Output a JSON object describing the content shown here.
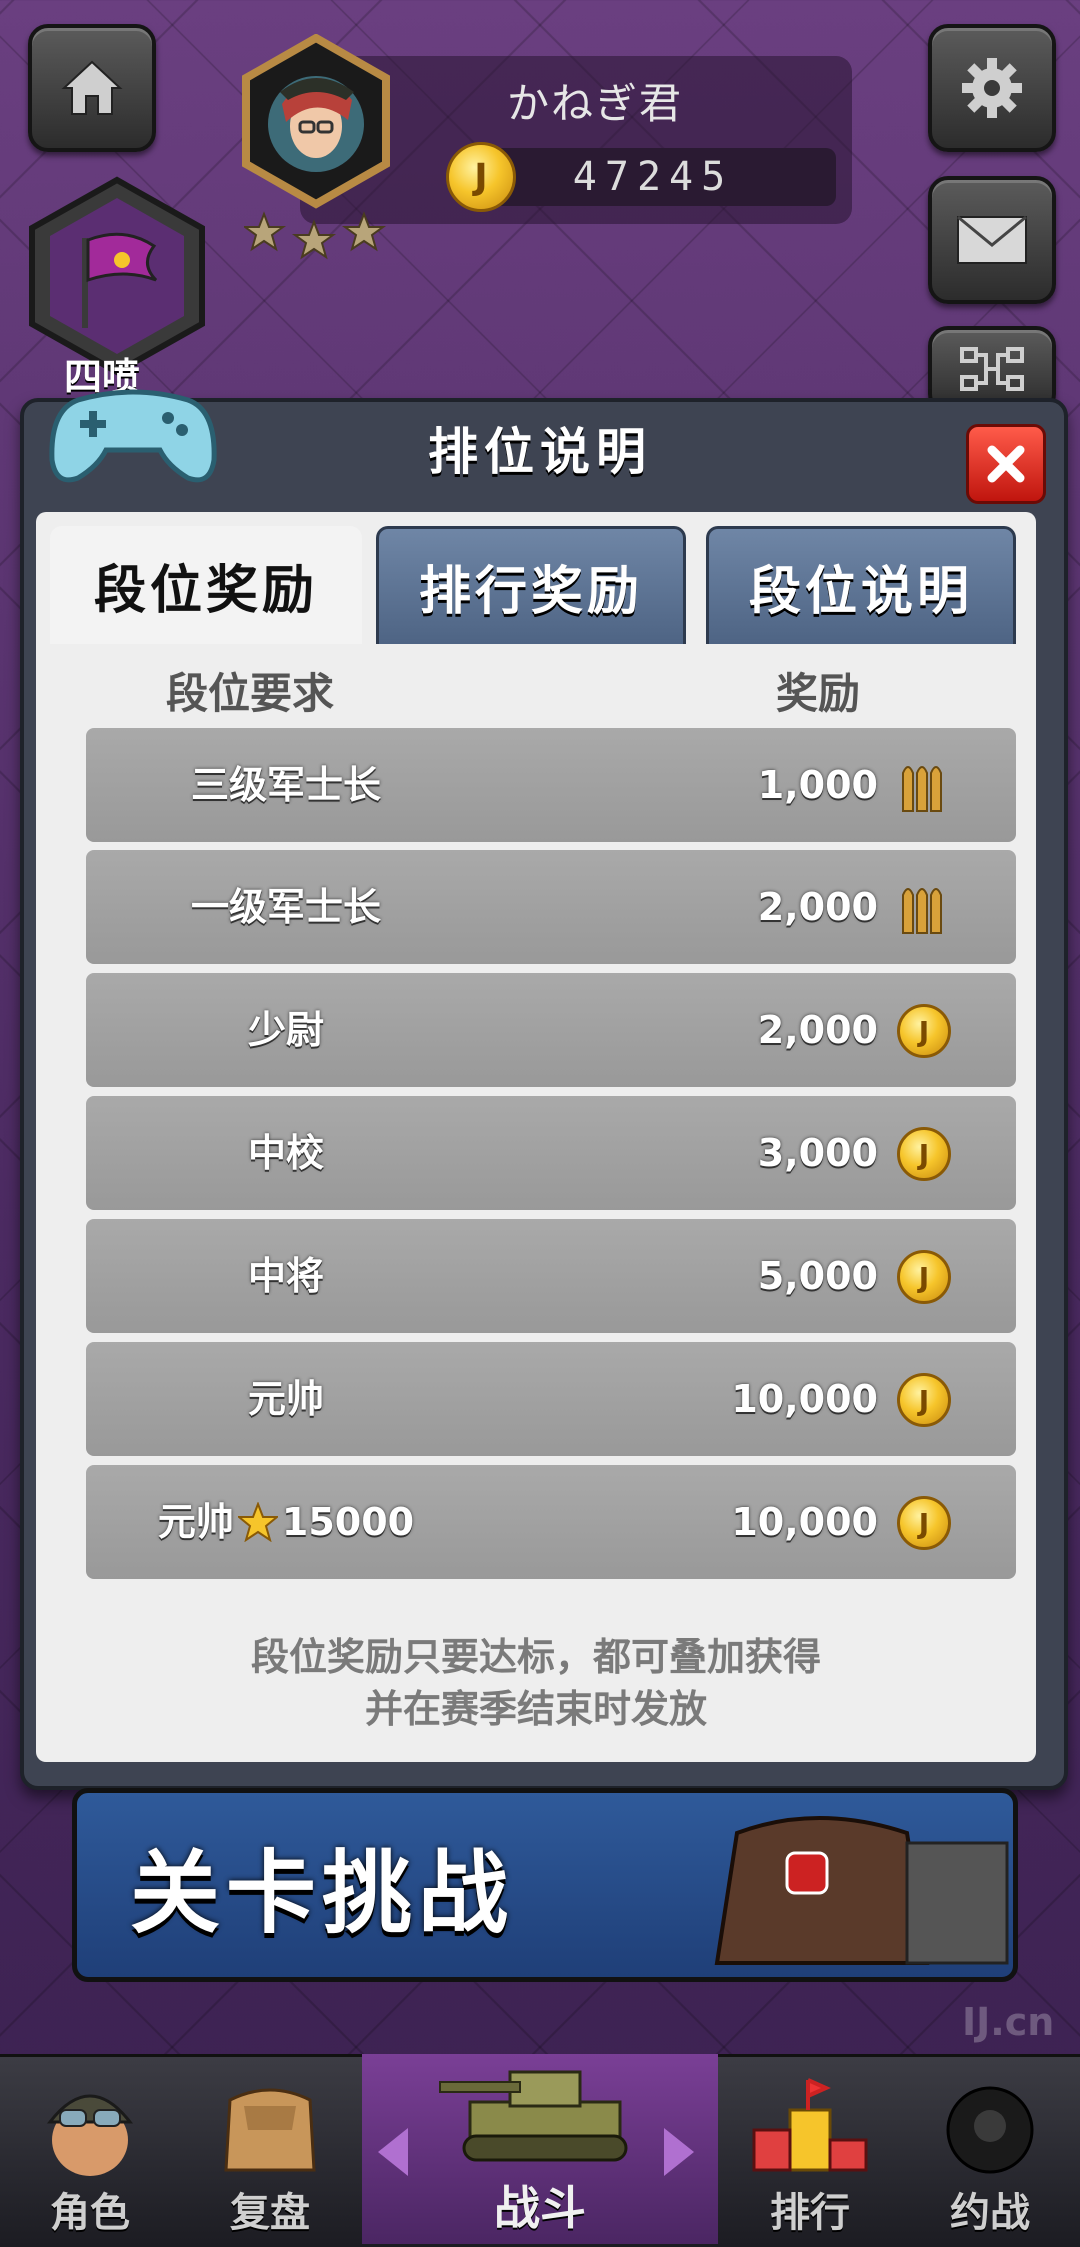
{
  "header": {
    "player_name": "かねぎ君",
    "coins": "47245",
    "stars": 3,
    "rank_badge_label": "四喷"
  },
  "modal": {
    "title": "排位说明",
    "tabs": [
      {
        "label": "段位奖励",
        "active": true
      },
      {
        "label": "排行奖励",
        "active": false
      },
      {
        "label": "段位说明",
        "active": false
      }
    ],
    "columns": {
      "requirement": "段位要求",
      "reward": "奖励"
    },
    "rows": [
      {
        "rank": "三级军士长",
        "reward": "1,000",
        "reward_icon": "bullets-icon"
      },
      {
        "rank": "一级军士长",
        "reward": "2,000",
        "reward_icon": "bullets-icon"
      },
      {
        "rank": "少尉",
        "reward": "2,000",
        "reward_icon": "gold-coin-icon"
      },
      {
        "rank": "中校",
        "reward": "3,000",
        "reward_icon": "gold-coin-icon"
      },
      {
        "rank": "中将",
        "reward": "5,000",
        "reward_icon": "gold-coin-icon"
      },
      {
        "rank": "元帅",
        "reward": "10,000",
        "reward_icon": "gold-coin-icon"
      },
      {
        "rank": "元帅",
        "rank_suffix": "15000",
        "reward": "10,000",
        "reward_icon": "gold-coin-icon"
      }
    ],
    "note_line1": "段位奖励只要达标，都可叠加获得",
    "note_line2": "并在赛季结束时发放"
  },
  "banner": {
    "label": "关卡挑战"
  },
  "watermark": "IJ.cn",
  "bottom_nav": [
    {
      "label": "角色"
    },
    {
      "label": "复盘"
    },
    {
      "label": "战斗"
    },
    {
      "label": "排行"
    },
    {
      "label": "约战"
    }
  ],
  "colors": {
    "accent_gold": "#f6c52b",
    "close_red": "#e0261c",
    "tab_blue": "#5c7394"
  }
}
